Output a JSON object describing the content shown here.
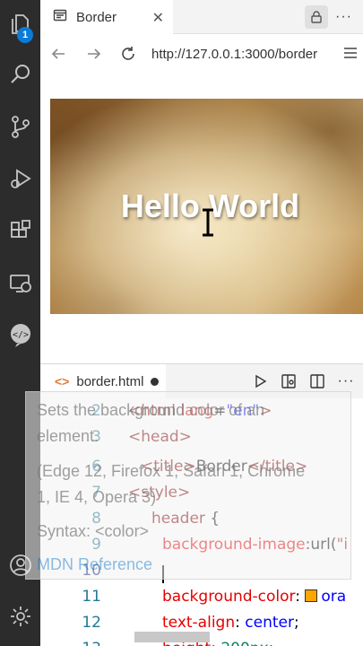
{
  "activity_bar": {
    "badge_count": "1",
    "items": [
      "explorer-icon",
      "search-icon",
      "source-control-icon",
      "run-debug-icon",
      "extensions-icon",
      "remote-explorer-icon",
      "live-preview-icon",
      "account-icon",
      "settings-gear-icon"
    ]
  },
  "browser": {
    "tab_title": "Border",
    "url": "http://127.0.0.1:3000/border",
    "page_heading": "Hello World"
  },
  "editor": {
    "tab_label": "border.html",
    "tab_code_icon": "<>",
    "lines": [
      {
        "num": "2",
        "code": "<html lang=\"en\">"
      },
      {
        "num": "3",
        "code": "<head>"
      },
      {
        "num": "6",
        "code": "<title>Border</title>"
      },
      {
        "num": "7",
        "code": "<style>"
      },
      {
        "num": "8",
        "code": "header {"
      },
      {
        "num": "9",
        "code": "background-image:url(\"i"
      },
      {
        "num": "10",
        "code": ""
      },
      {
        "num": "11",
        "code": "background-color: ora"
      },
      {
        "num": "12",
        "code": "text-align: center;"
      },
      {
        "num": "13",
        "code": "height: 200px;"
      }
    ]
  },
  "hover": {
    "line1": "Sets the background color of an",
    "line2": "element.",
    "line3": "(Edge 12, Firefox 1, Safari 1, Chrome",
    "line4": "1, IE 4, Opera 3)",
    "line5": "Syntax: <color>",
    "link": "MDN Reference"
  },
  "colors": {
    "activity_bg": "#2c2c2c",
    "badge": "#0a7bd6",
    "swatch_orange": "#ffa500"
  }
}
